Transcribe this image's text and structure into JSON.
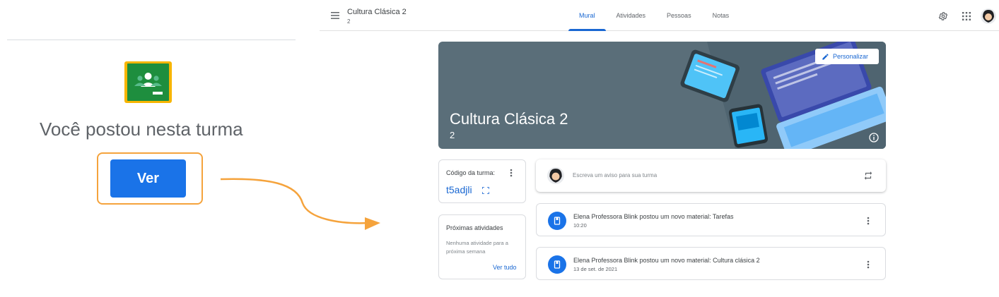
{
  "notification": {
    "message": "Você postou nesta turma",
    "button_label": "Ver"
  },
  "header": {
    "class_title": "Cultura Clásica 2",
    "class_section": "2",
    "tabs": [
      {
        "label": "Mural",
        "active": true
      },
      {
        "label": "Atividades",
        "active": false
      },
      {
        "label": "Pessoas",
        "active": false
      },
      {
        "label": "Notas",
        "active": false
      }
    ],
    "icons": [
      "menu-icon",
      "gear-icon",
      "apps-grid-icon",
      "account-avatar"
    ]
  },
  "banner": {
    "title": "Cultura Clásica 2",
    "section": "2",
    "customize_label": "Personalizar",
    "color": "#5a6e79"
  },
  "class_code": {
    "label": "Código da turma:",
    "value": "t5adjli"
  },
  "upcoming": {
    "title": "Próximas atividades",
    "empty_message": "Nenhuma atividade para a próxima semana",
    "link_label": "Ver tudo"
  },
  "announce": {
    "placeholder": "Escreva um aviso para sua turma"
  },
  "posts": [
    {
      "title": "Elena Professora Blink postou um novo material: Tarefas",
      "time": "10:20"
    },
    {
      "title": "Elena Professora Blink postou um novo material: Cultura clásica 2",
      "time": "13 de set. de 2021"
    }
  ],
  "colors": {
    "accent": "#1a73e8",
    "link": "#1967d2",
    "highlight": "#f5a33c",
    "classroom_green": "#1e8e3e",
    "classroom_yellow": "#f7b500"
  }
}
